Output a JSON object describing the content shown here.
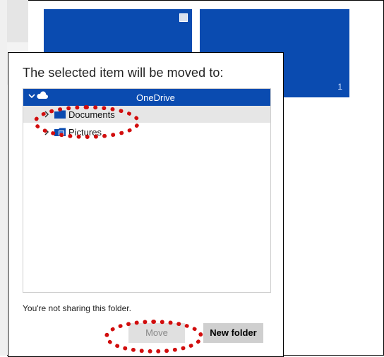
{
  "dialog": {
    "title": "The selected item will be moved to:",
    "tree": {
      "root": {
        "label": "OneDrive",
        "icon": "cloud-icon",
        "expanded": true
      },
      "items": [
        {
          "label": "Documents",
          "icon": "folder-icon",
          "selected": true
        },
        {
          "label": "Pictures",
          "icon": "pictures-folder-icon",
          "selected": false
        }
      ]
    },
    "sharing_note": "You're not sharing this folder.",
    "buttons": {
      "move_label": "Move",
      "new_folder_label": "New folder"
    }
  },
  "background": {
    "tile_count": "1"
  },
  "colors": {
    "accent": "#0a4bb0",
    "highlight_ring": "#d10d0d",
    "selected_row": "#e6e6e6"
  }
}
